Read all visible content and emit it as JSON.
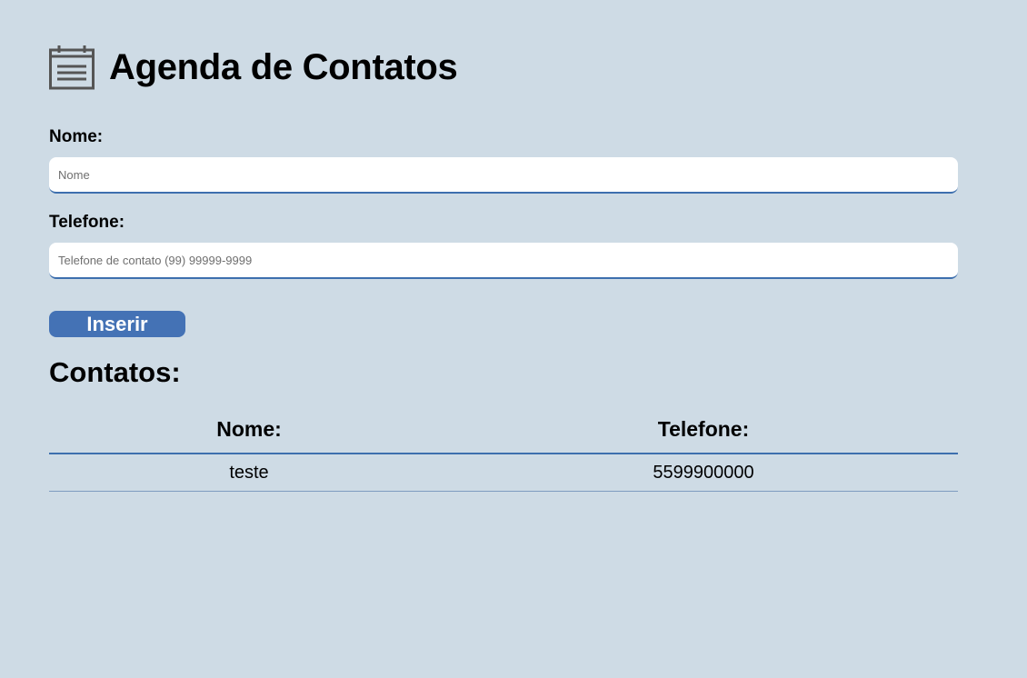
{
  "header": {
    "icon": "calendar-icon",
    "title": "Agenda de Contatos"
  },
  "form": {
    "name_label": "Nome:",
    "name_placeholder": "Nome",
    "name_value": "",
    "phone_label": "Telefone:",
    "phone_placeholder": "Telefone de contato (99) 99999-9999",
    "phone_value": "",
    "submit_label": "Inserir"
  },
  "contacts": {
    "title": "Contatos:",
    "columns": [
      "Nome:",
      "Telefone:"
    ],
    "rows": [
      [
        "teste",
        "5599900000"
      ]
    ]
  },
  "colors": {
    "background": "#cedbe5",
    "accent": "#4472b5",
    "border": "#3d6fae"
  }
}
